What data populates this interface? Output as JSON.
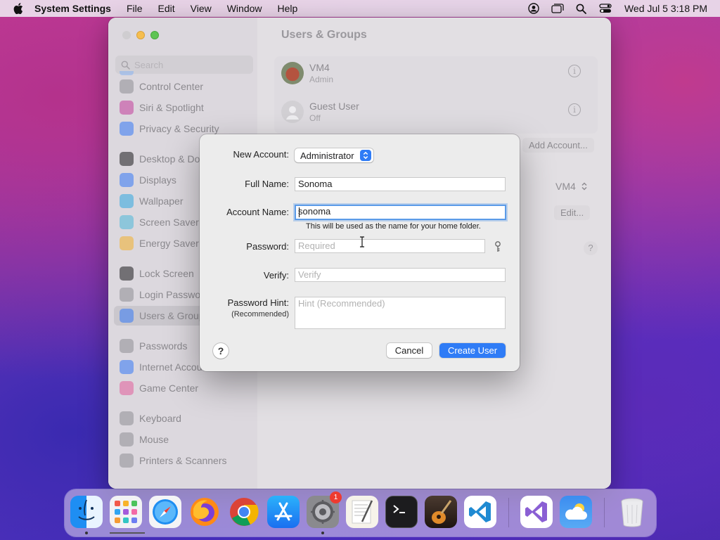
{
  "menubar": {
    "app_name": "System Settings",
    "menus": [
      "File",
      "Edit",
      "View",
      "Window",
      "Help"
    ],
    "clock": "Wed Jul 5  3:18 PM",
    "status_icons": [
      "user-icon",
      "window-icon",
      "search-icon",
      "control-center-icon"
    ]
  },
  "window": {
    "title": "Users & Groups",
    "search_placeholder": "Search",
    "sidebar": [
      {
        "label": "Control Center",
        "icon": "control-center-icon",
        "color": "#8e8e93"
      },
      {
        "label": "Siri & Spotlight",
        "icon": "siri-icon",
        "color": "#c23d9b"
      },
      {
        "label": "Privacy & Security",
        "icon": "hand-icon",
        "color": "#3478f6"
      },
      {
        "label": "Desktop & Dock",
        "icon": "dock-icon",
        "color": "#1c1c1e"
      },
      {
        "label": "Displays",
        "icon": "sun-icon",
        "color": "#3478f6"
      },
      {
        "label": "Wallpaper",
        "icon": "wallpaper-icon",
        "color": "#2fa8e0"
      },
      {
        "label": "Screen Saver",
        "icon": "screensaver-icon",
        "color": "#4cb8d8"
      },
      {
        "label": "Energy Saver",
        "icon": "bulb-icon",
        "color": "#f2b02c"
      },
      {
        "label": "Lock Screen",
        "icon": "lock-icon",
        "color": "#1c1c1e"
      },
      {
        "label": "Login Password",
        "icon": "lock-icon",
        "color": "#8e8e93"
      },
      {
        "label": "Users & Groups",
        "icon": "users-icon",
        "color": "#3478f6"
      },
      {
        "label": "Passwords",
        "icon": "key-icon",
        "color": "#8e8e93"
      },
      {
        "label": "Internet Accounts",
        "icon": "at-icon",
        "color": "#3478f6"
      },
      {
        "label": "Game Center",
        "icon": "game-center-icon",
        "color": "#e25c9a"
      },
      {
        "label": "Keyboard",
        "icon": "keyboard-icon",
        "color": "#8e8e93"
      },
      {
        "label": "Mouse",
        "icon": "mouse-icon",
        "color": "#8e8e93"
      },
      {
        "label": "Printers & Scanners",
        "icon": "printer-icon",
        "color": "#8e8e93"
      }
    ],
    "users": [
      {
        "name": "VM4",
        "role": "Admin"
      },
      {
        "name": "Guest User",
        "role": "Off"
      }
    ],
    "add_account_label": "Add Account...",
    "auto_login_value": "VM4",
    "edit_label": "Edit...",
    "help_label": "?"
  },
  "dialog": {
    "new_account_label": "New Account:",
    "new_account_value": "Administrator",
    "full_name_label": "Full Name:",
    "full_name_value": "Sonoma",
    "account_name_label": "Account Name:",
    "account_name_value": "sonoma",
    "account_name_hint": "This will be used as the name for your home folder.",
    "password_label": "Password:",
    "password_placeholder": "Required",
    "verify_label": "Verify:",
    "verify_placeholder": "Verify",
    "hint_label": "Password Hint:",
    "hint_sublabel": "(Recommended)",
    "hint_placeholder": "Hint (Recommended)",
    "help_label": "?",
    "cancel_label": "Cancel",
    "create_label": "Create User",
    "accent_color": "#2f7cf6"
  },
  "dock": {
    "apps": [
      "finder-icon",
      "launchpad-icon",
      "safari-icon",
      "firefox-icon",
      "chrome-icon",
      "app-store-icon",
      "system-settings-icon",
      "textedit-icon",
      "terminal-icon",
      "garageband-icon",
      "vscode-icon",
      "visual-studio-icon",
      "weather-icon",
      "trash-icon"
    ],
    "settings_badge": "1"
  }
}
